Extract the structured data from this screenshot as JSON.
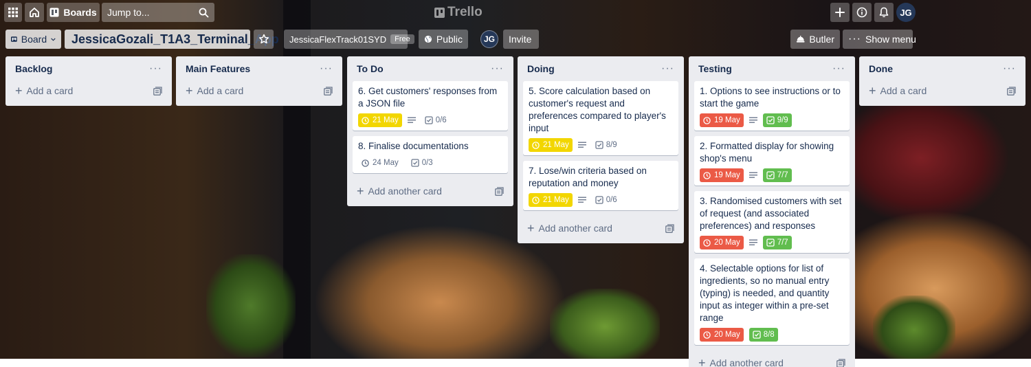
{
  "header": {
    "boards_label": "Boards",
    "search_placeholder": "Jump to...",
    "logo_text": "Trello",
    "avatar_initials": "JG"
  },
  "board": {
    "view_label": "Board",
    "title": "JessicaGozali_T1A3_Terminal_App",
    "workspace": "JessicaFlexTrack01SYD",
    "workspace_badge": "Free",
    "visibility": "Public",
    "member_initials": "JG",
    "invite_label": "Invite",
    "butler_label": "Butler",
    "menu_label": "Show menu"
  },
  "colors": {
    "list_bg": "#ebecf0",
    "due_yellow": "#f2d600",
    "due_red": "#eb5a46",
    "checklist_green": "#61bd4f",
    "avatar_bg": "#253858"
  },
  "lists": [
    {
      "title": "Backlog",
      "add_label": "Add a card",
      "cards": []
    },
    {
      "title": "Main Features",
      "add_label": "Add a card",
      "cards": []
    },
    {
      "title": "To Do",
      "add_label": "Add another card",
      "cards": [
        {
          "title": "6. Get customers' responses from a JSON file",
          "due": "21 May",
          "checklist": "0/6"
        },
        {
          "title": "8. Finalise documentations",
          "due": "24 May",
          "checklist": "0/3"
        }
      ]
    },
    {
      "title": "Doing",
      "add_label": "Add another card",
      "cards": [
        {
          "title": "5. Score calculation based on customer's request and preferences compared to player's input",
          "due": "21 May",
          "checklist": "8/9"
        },
        {
          "title": "7. Lose/win criteria based on reputation and money",
          "due": "21 May",
          "checklist": "0/6"
        }
      ]
    },
    {
      "title": "Testing",
      "add_label": "Add another card",
      "cards": [
        {
          "title": "1. Options to see instructions or to start the game",
          "due": "19 May",
          "checklist": "9/9"
        },
        {
          "title": "2. Formatted display for showing shop's menu",
          "due": "19 May",
          "checklist": "7/7"
        },
        {
          "title": "3. Randomised customers with set of request (and associated preferences) and responses",
          "due": "20 May",
          "checklist": "7/7"
        },
        {
          "title": "4. Selectable options for list of ingredients, so no manual entry (typing) is needed, and quantity input as integer within a pre-set range",
          "due": "20 May",
          "checklist": "8/8"
        }
      ]
    },
    {
      "title": "Done",
      "add_label": "Add a card",
      "cards": []
    }
  ]
}
